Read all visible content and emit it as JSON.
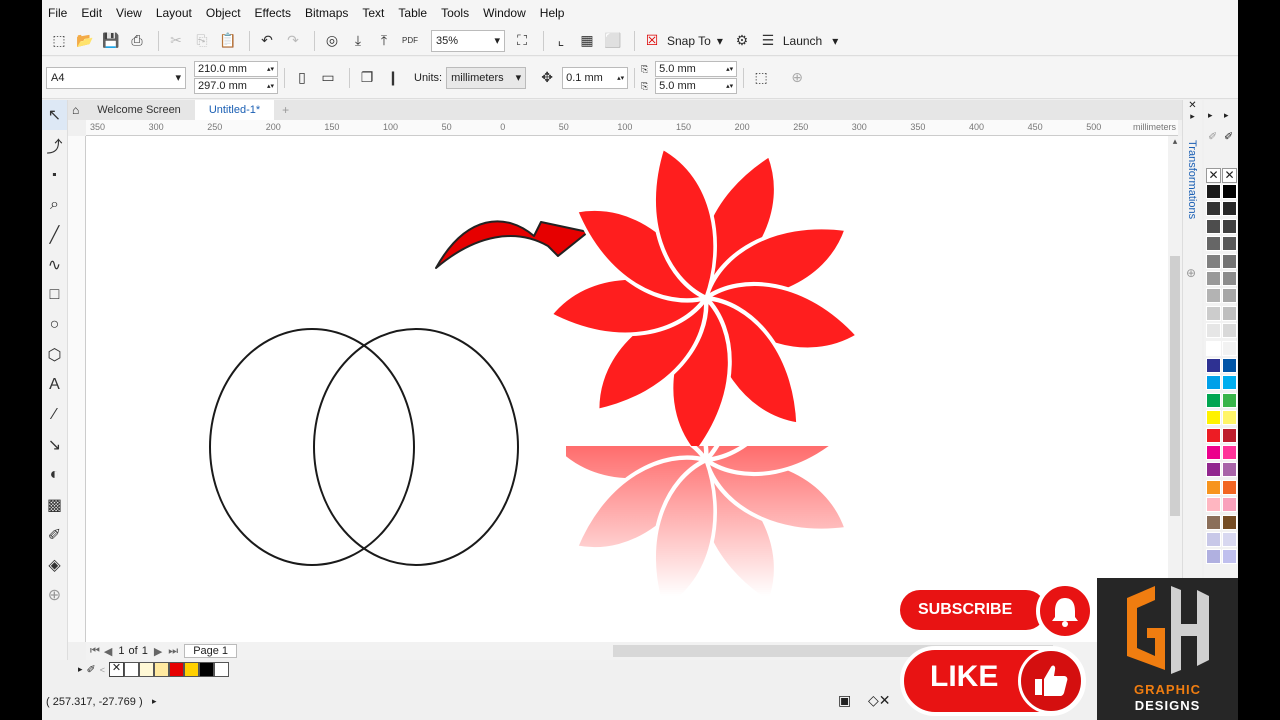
{
  "menu": [
    "File",
    "Edit",
    "View",
    "Layout",
    "Object",
    "Effects",
    "Bitmaps",
    "Text",
    "Table",
    "Tools",
    "Window",
    "Help"
  ],
  "toolbar": {
    "zoom": "35%",
    "snap_to": "Snap To",
    "launch": "Launch"
  },
  "property_bar": {
    "page_size": "A4",
    "width": "210.0 mm",
    "height": "297.0 mm",
    "units_label": "Units:",
    "units": "millimeters",
    "nudge": "0.1 mm",
    "dup_x": "5.0 mm",
    "dup_y": "5.0 mm"
  },
  "tabs": [
    "Welcome Screen",
    "Untitled-1*"
  ],
  "ruler": {
    "labels": [
      "350",
      "300",
      "250",
      "200",
      "150",
      "100",
      "50",
      "0",
      "50",
      "100",
      "150",
      "200",
      "250",
      "300",
      "350",
      "400",
      "450",
      "500"
    ],
    "units": "millimeters"
  },
  "docker": {
    "title": "Transformations"
  },
  "page_nav": {
    "current": "1",
    "of_label": "of",
    "total": "1",
    "page_tab": "Page 1"
  },
  "status": {
    "coords": "( 257.317, -27.769 )"
  },
  "overlay": {
    "subscribe": "SUBSCRIBE",
    "like": "LIKE",
    "brand_line1": "GRAPHIC",
    "brand_line2": "DESIGNS"
  },
  "colors": {
    "accent": "#e81313",
    "petal_light": "#ff1a1a",
    "petal_dark": "#b30000",
    "ui_bg": "#f0f0f0"
  },
  "palette": {
    "col1": [
      "#1a1a1a",
      "#333333",
      "#4d4d4d",
      "#666666",
      "#808080",
      "#999999",
      "#b3b3b3",
      "#cccccc",
      "#e6e6e6",
      "#ffffff",
      "#2e3192",
      "#00a0e9",
      "#00a651",
      "#fff200",
      "#ed1c24",
      "#ec008c",
      "#92278f",
      "#f7941d",
      "#ffb6c1",
      "#8b6f5a",
      "#c8c8e8",
      "#b0b0e0"
    ],
    "col2": [
      "#000000",
      "#262626",
      "#404040",
      "#595959",
      "#737373",
      "#8c8c8c",
      "#a6a6a6",
      "#bfbfbf",
      "#d9d9d9",
      "#f2f2f2",
      "#0054a6",
      "#00aeef",
      "#39b54a",
      "#fff568",
      "#be1e2d",
      "#ff3399",
      "#a864a8",
      "#f26522",
      "#f9a1bc",
      "#754c24",
      "#d8d8f0",
      "#c0c0ee"
    ]
  },
  "document_palette": [
    "#ffffff",
    "#fff8d6",
    "#ffe9a0",
    "#e60000",
    "#ffd000",
    "#000000",
    "#ffffff"
  ]
}
